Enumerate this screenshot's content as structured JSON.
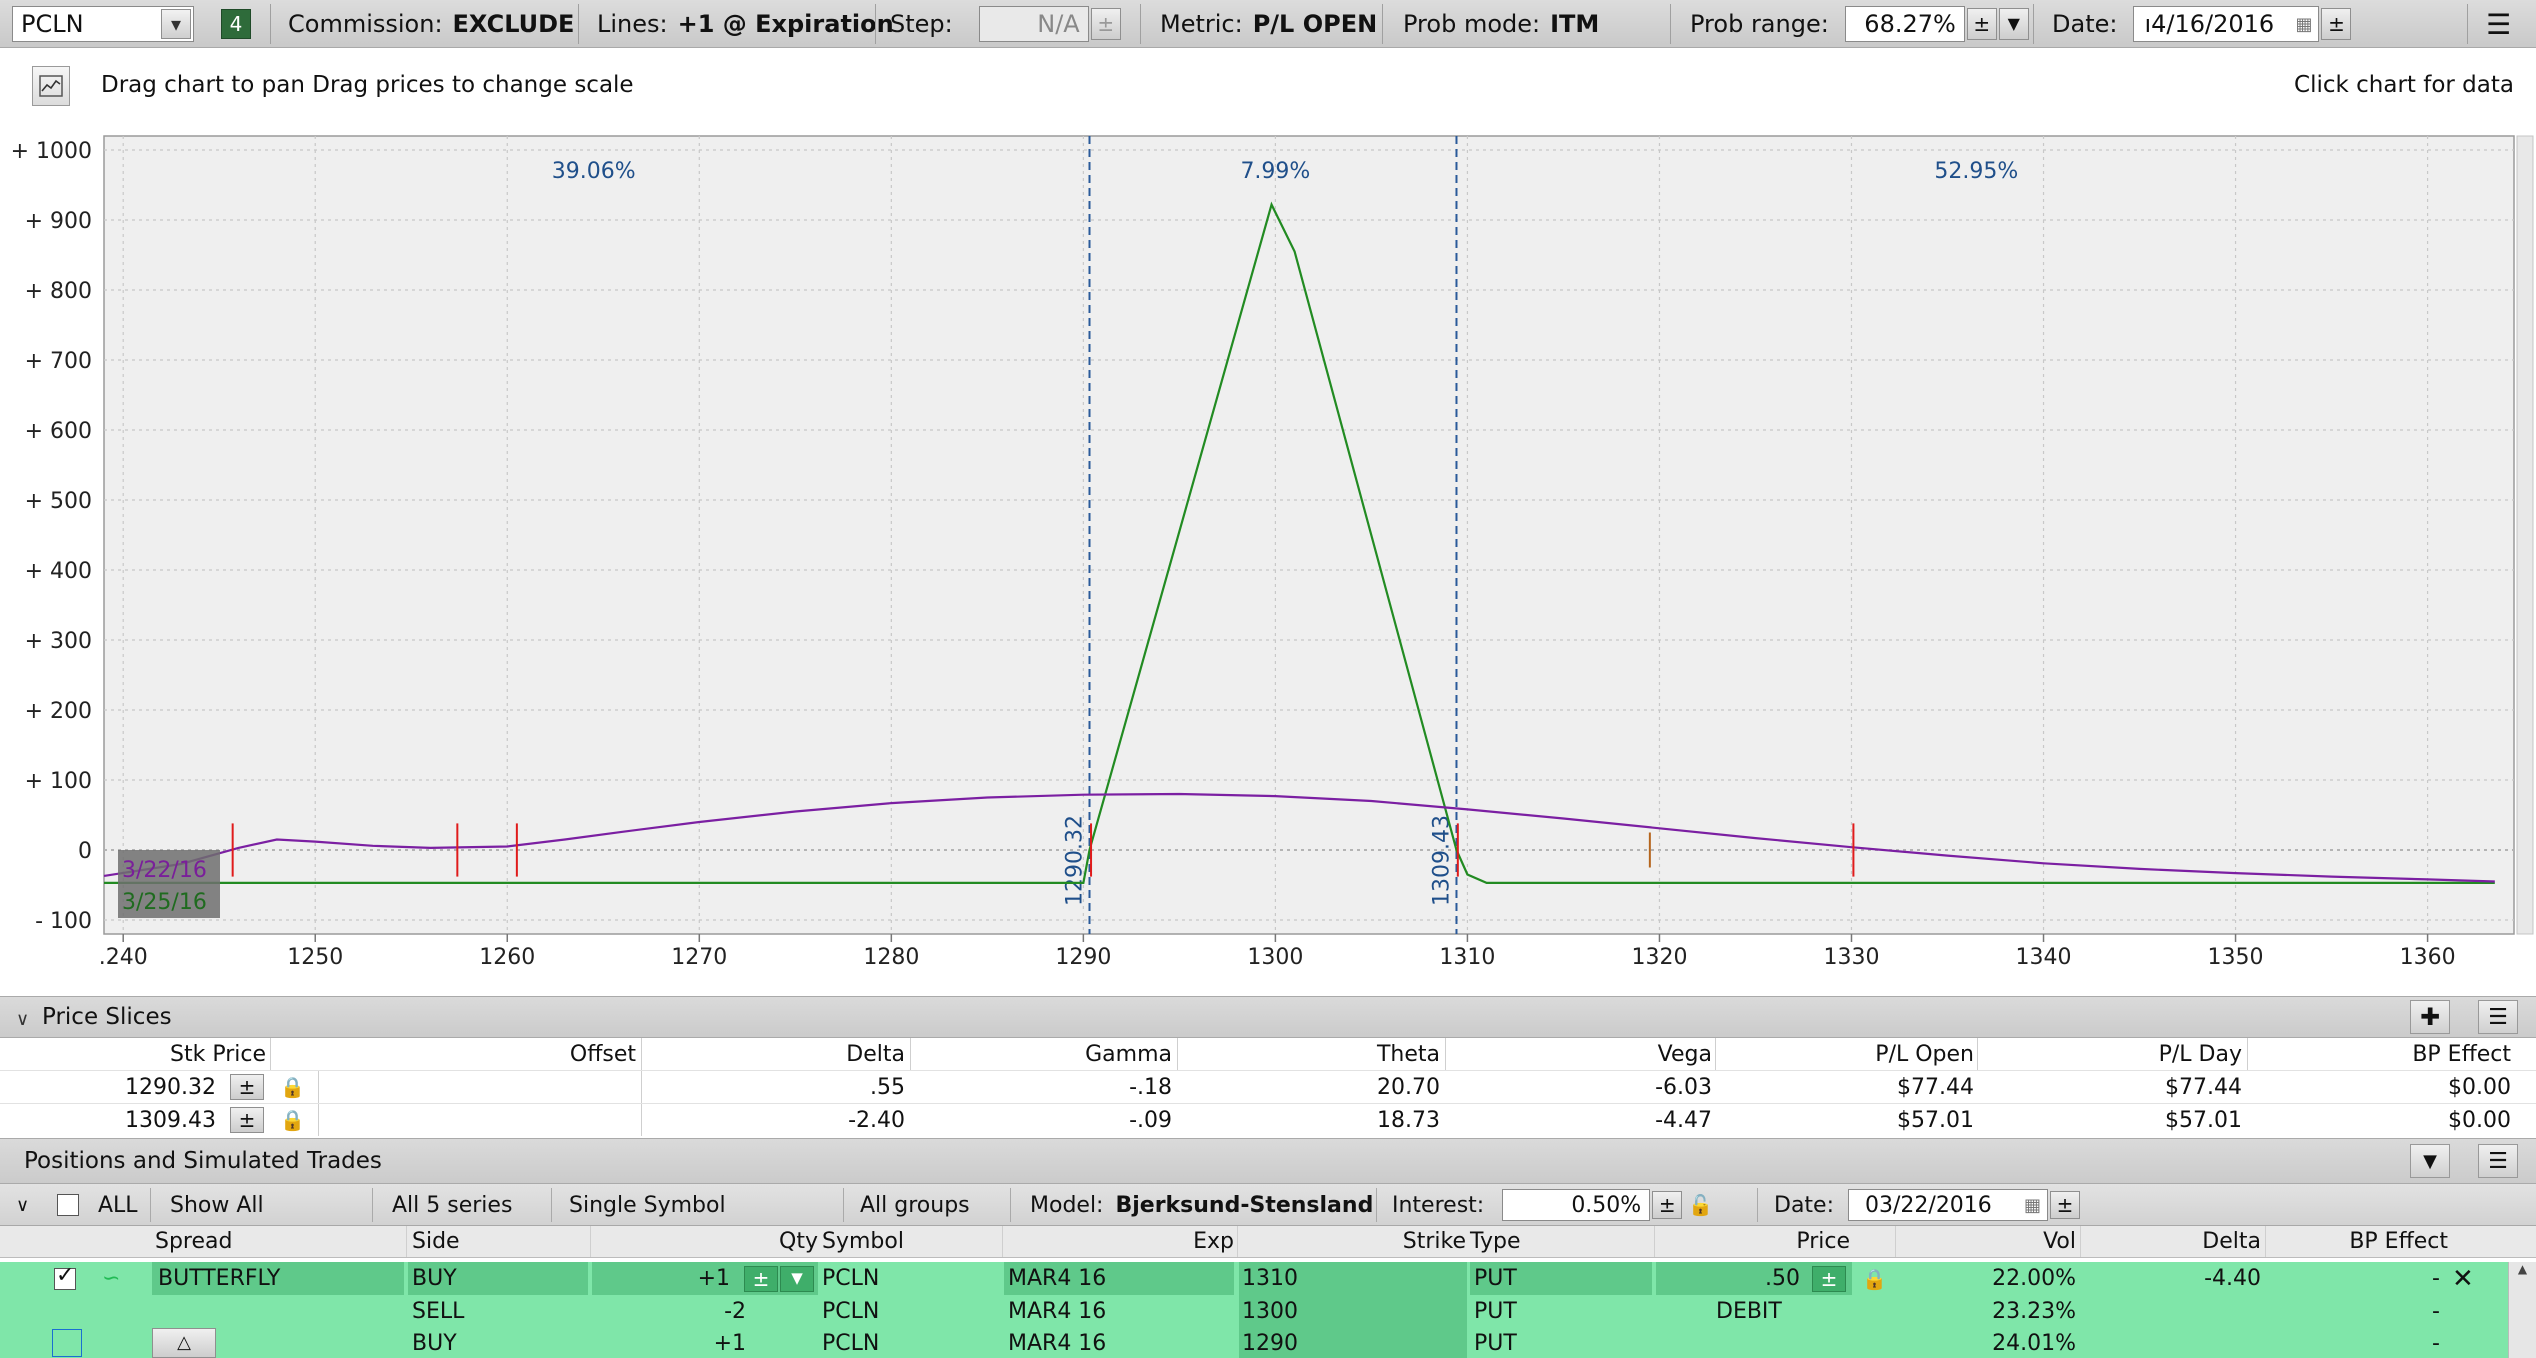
{
  "toolbar": {
    "symbol": "PCLN",
    "badge": "4",
    "commission_label": "Commission:",
    "commission_value": "EXCLUDE",
    "lines_label": "Lines:",
    "lines_value": "+1 @ Expiration",
    "step_label": "Step:",
    "step_value": "N/A",
    "metric_label": "Metric:",
    "metric_value": "P/L OPEN",
    "probmode_label": "Prob mode:",
    "probmode_value": "ITM",
    "probrange_label": "Prob range:",
    "probrange_value": "68.27%",
    "date_label": "Date:",
    "date_value": "ı4/16/2016"
  },
  "chart_header": {
    "hint_left": "Drag chart to pan Drag prices to change scale",
    "hint_right": "Click chart for data"
  },
  "chart_data": {
    "type": "line",
    "x_ticks": [
      ".240",
      "1250",
      "1260",
      "1270",
      "1280",
      "1290",
      "1300",
      "1310",
      "1320",
      "1330",
      "1340",
      "1350",
      "1360"
    ],
    "x_tick_values": [
      1240,
      1250,
      1260,
      1270,
      1280,
      1290,
      1300,
      1310,
      1320,
      1330,
      1340,
      1350,
      1360
    ],
    "y_ticks": [
      "+ 1000",
      "+ 900",
      "+ 800",
      "+ 700",
      "+ 600",
      "+ 500",
      "+ 400",
      "+ 300",
      "+ 200",
      "+ 100",
      "0",
      "- 100"
    ],
    "y_tick_values": [
      1000,
      900,
      800,
      700,
      600,
      500,
      400,
      300,
      200,
      100,
      0,
      -100
    ],
    "xlim": [
      1239,
      1364.5
    ],
    "ylim": [
      -120,
      1020
    ],
    "grid": true,
    "probabilities": [
      {
        "label": "39.06%",
        "x": 1264.5
      },
      {
        "label": "7.99%",
        "x": 1300
      },
      {
        "label": "52.95%",
        "x": 1336.5
      }
    ],
    "breakevens": [
      {
        "label": "1290.32",
        "x": 1290.32
      },
      {
        "label": "1309.43",
        "x": 1309.43
      }
    ],
    "date_labels": [
      {
        "label": "3/22/16",
        "color": "#7a1f9a"
      },
      {
        "label": "3/25/16",
        "color": "#1f6b1f"
      }
    ],
    "series": [
      {
        "name": "3/25/16",
        "color": "#228b22",
        "points": [
          [
            1239,
            -47
          ],
          [
            1290,
            -47
          ],
          [
            1290.32,
            0
          ],
          [
            1299.8,
            922
          ],
          [
            1301,
            855
          ],
          [
            1309.43,
            0
          ],
          [
            1310,
            -35
          ],
          [
            1311,
            -47
          ],
          [
            1363.5,
            -47
          ]
        ]
      },
      {
        "name": "3/22/16",
        "color": "#7b1fa2",
        "points": [
          [
            1239,
            -37
          ],
          [
            1243,
            -20
          ],
          [
            1246,
            3
          ],
          [
            1248,
            15
          ],
          [
            1250,
            12
          ],
          [
            1253,
            6
          ],
          [
            1256,
            3
          ],
          [
            1260,
            5
          ],
          [
            1263,
            15
          ],
          [
            1266,
            26
          ],
          [
            1270,
            40
          ],
          [
            1275,
            55
          ],
          [
            1280,
            67
          ],
          [
            1285,
            75
          ],
          [
            1290,
            79
          ],
          [
            1295,
            80
          ],
          [
            1300,
            77
          ],
          [
            1305,
            70
          ],
          [
            1310,
            58
          ],
          [
            1315,
            45
          ],
          [
            1320,
            31
          ],
          [
            1325,
            17
          ],
          [
            1330,
            4
          ],
          [
            1335,
            -8
          ],
          [
            1340,
            -19
          ],
          [
            1345,
            -27
          ],
          [
            1350,
            -33
          ],
          [
            1355,
            -38
          ],
          [
            1360,
            -42
          ],
          [
            1363.5,
            -45
          ]
        ]
      }
    ],
    "markers_red": [
      1245.7,
      1257.4,
      1260.5,
      1290.4,
      1309.5,
      1330.1
    ],
    "markers_brown": [
      1319.5
    ]
  },
  "price_slices": {
    "title": "Price Slices",
    "columns": [
      "Stk Price",
      "Offset",
      "Delta",
      "Gamma",
      "Theta",
      "Vega",
      "P/L Open",
      "P/L Day",
      "BP Effect"
    ],
    "rows": [
      {
        "stk": "1290.32",
        "offset": "",
        "delta": ".55",
        "gamma": "-.18",
        "theta": "20.70",
        "vega": "-6.03",
        "pl_open": "$77.44",
        "pl_day": "$77.44",
        "bp": "$0.00"
      },
      {
        "stk": "1309.43",
        "offset": "",
        "delta": "-2.40",
        "gamma": "-.09",
        "theta": "18.73",
        "vega": "-4.47",
        "pl_open": "$57.01",
        "pl_day": "$57.01",
        "bp": "$0.00"
      }
    ]
  },
  "positions": {
    "title": "Positions and Simulated Trades",
    "all_label": "ALL",
    "filter_show": "Show All",
    "filter_series": "All 5 series",
    "filter_symbol": "Single Symbol",
    "filter_groups": "All groups",
    "model_label": "Model:",
    "model_value": "Bjerksund-Stensland",
    "interest_label": "Interest:",
    "interest_value": "0.50%",
    "date_label": "Date:",
    "date_value": "03/22/2016",
    "columns": [
      "Spread",
      "Side",
      "Qty",
      "Symbol",
      "Exp",
      "Strike",
      "Type",
      "Price",
      "Vol",
      "Delta",
      "BP Effect"
    ],
    "rows": [
      {
        "spread": "BUTTERFLY",
        "side": "BUY",
        "qty": "+1",
        "symbol": "PCLN",
        "exp": "MAR4 16",
        "strike": "1310",
        "type": "PUT",
        "price": ".50",
        "vol": "22.00%",
        "delta": "-4.40",
        "bp": "-"
      },
      {
        "spread": "",
        "side": "SELL",
        "qty": "-2",
        "symbol": "PCLN",
        "exp": "MAR4 16",
        "strike": "1300",
        "type": "PUT",
        "price": "DEBIT",
        "vol": "23.23%",
        "delta": "",
        "bp": "-"
      },
      {
        "spread": "",
        "side": "BUY",
        "qty": "+1",
        "symbol": "PCLN",
        "exp": "MAR4 16",
        "strike": "1290",
        "type": "PUT",
        "price": "",
        "vol": "24.01%",
        "delta": "",
        "bp": "-"
      }
    ]
  }
}
